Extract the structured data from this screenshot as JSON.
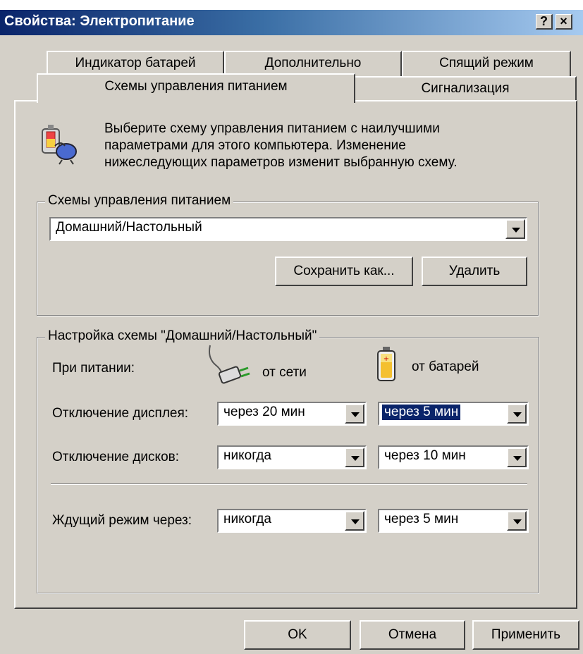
{
  "window": {
    "title": "Свойства: Электропитание",
    "help_label": "?",
    "close_label": "×"
  },
  "tabs": {
    "back_row": [
      "Индикатор батарей",
      "Дополнительно",
      "Спящий режим"
    ],
    "front_row": [
      "Схемы управления питанием",
      "Сигнализация"
    ],
    "active": "Схемы управления питанием"
  },
  "intro": {
    "text_line1": "Выберите схему управления питанием с наилучшими",
    "text_line2": "параметрами для этого компьютера. Изменение",
    "text_line3": "нижеследующих параметров изменит выбранную схему."
  },
  "schemes_group": {
    "legend": "Схемы управления питанием",
    "selected": "Домашний/Настольный",
    "save_as_label": "Сохранить как...",
    "delete_label": "Удалить"
  },
  "settings_group": {
    "legend": "Настройка схемы \"Домашний/Настольный\"",
    "power_label": "При питании:",
    "ac_label": "от сети",
    "battery_label": "от батарей",
    "rows": [
      {
        "label": "Отключение дисплея:",
        "ac": "через 20 мин",
        "battery": "через 5 мин"
      },
      {
        "label": "Отключение дисков:",
        "ac": "никогда",
        "battery": "через 10 мин"
      },
      {
        "label": "Ждущий режим через:",
        "ac": "никогда",
        "battery": "через 5 мин"
      }
    ]
  },
  "footer": {
    "ok_label": "OK",
    "cancel_label": "Отмена",
    "apply_label": "Применить"
  }
}
